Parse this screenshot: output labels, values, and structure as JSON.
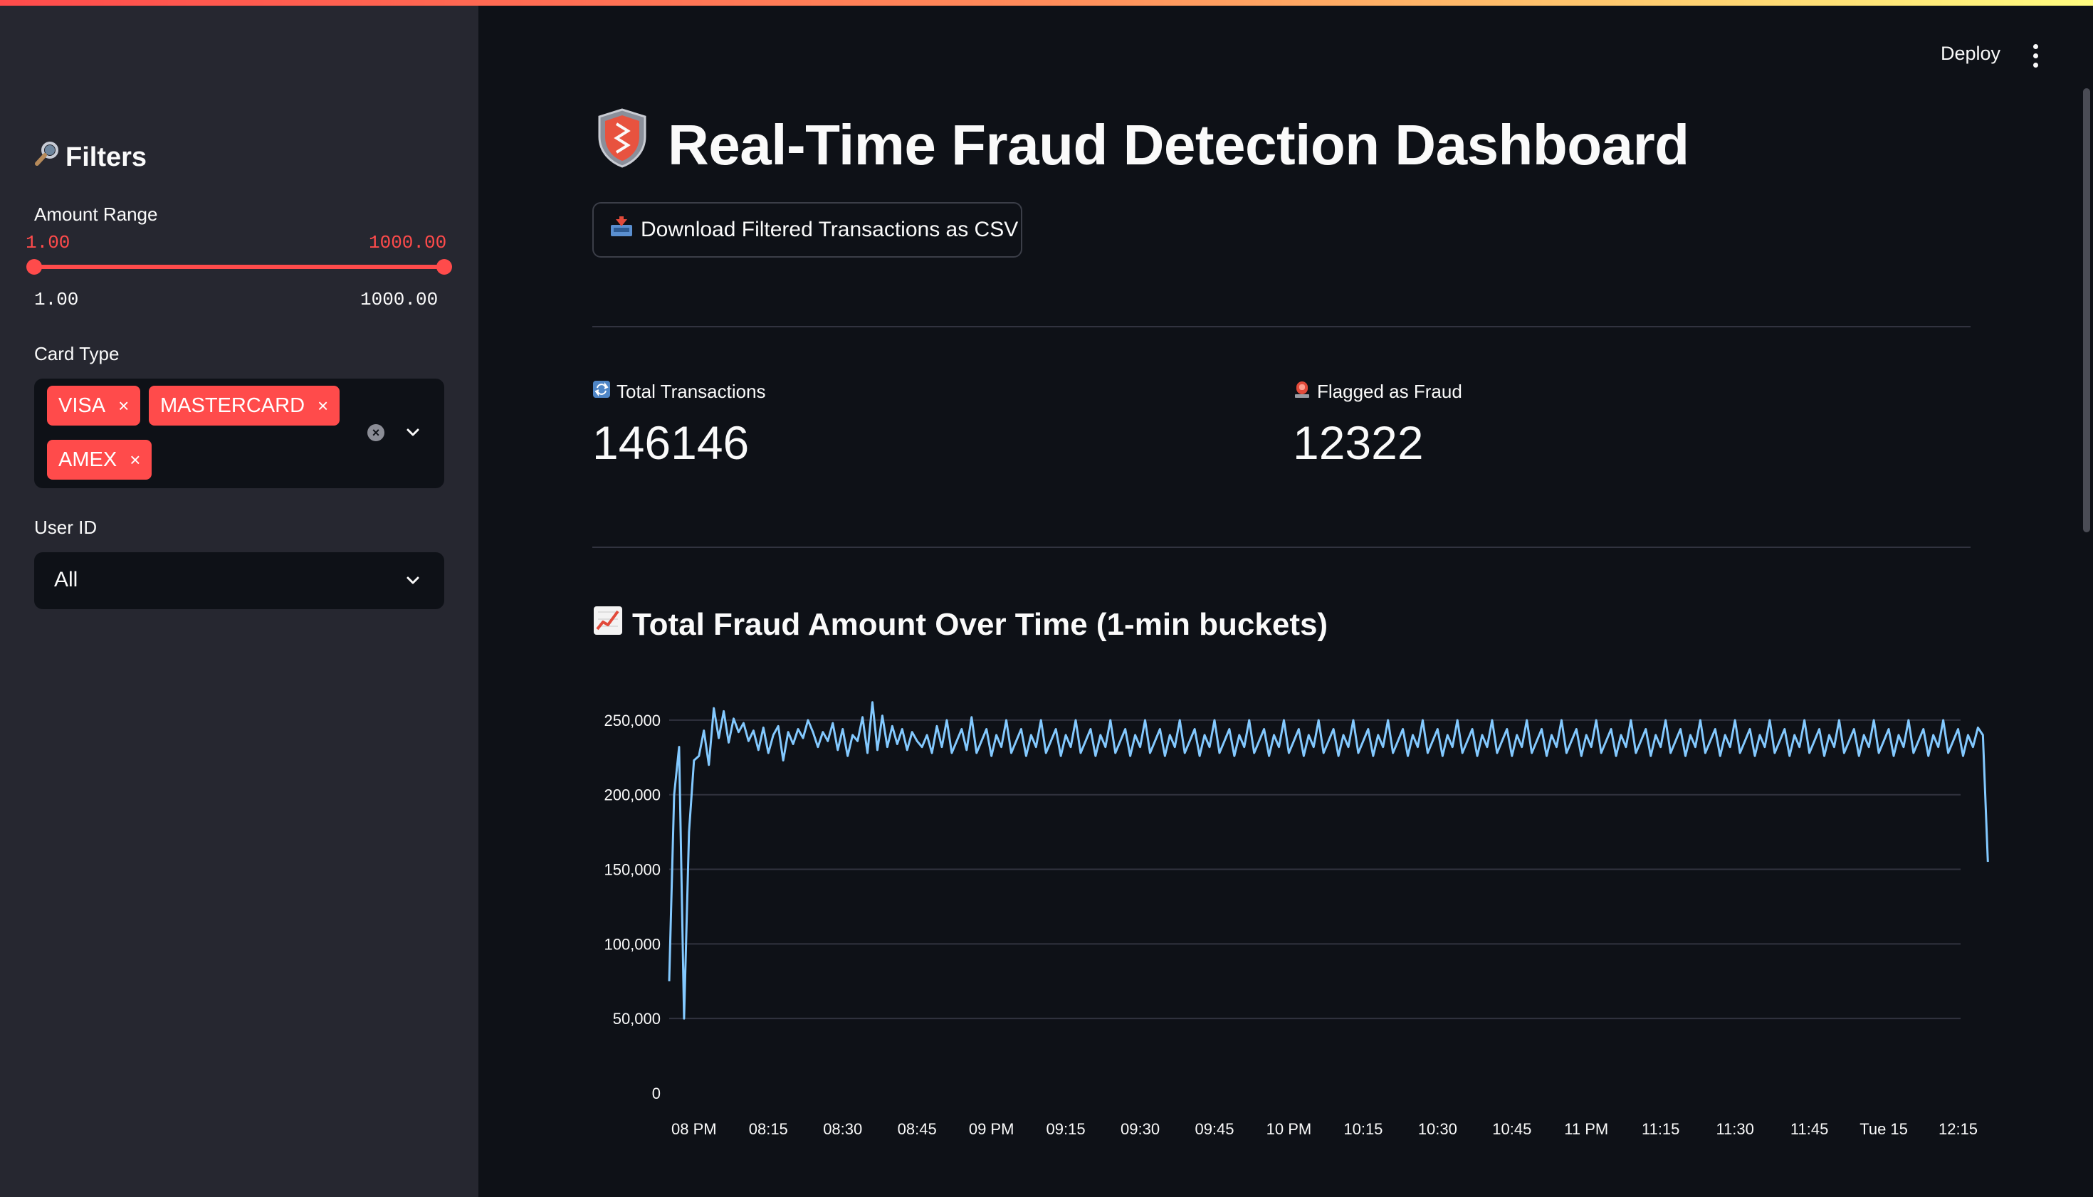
{
  "header": {
    "deploy_label": "Deploy"
  },
  "sidebar": {
    "title": "Filters",
    "title_icon": "magnifier-icon",
    "amount_range": {
      "label": "Amount Range",
      "min_selected": "1.00",
      "max_selected": "1000.00",
      "min_bound": "1.00",
      "max_bound": "1000.00",
      "range_fraction": [
        0,
        1
      ]
    },
    "card_type": {
      "label": "Card Type",
      "chips": [
        "VISA",
        "MASTERCARD",
        "AMEX"
      ],
      "chip_remove_glyph": "×"
    },
    "user_id": {
      "label": "User ID",
      "value": "All"
    }
  },
  "main": {
    "title": "Real-Time Fraud Detection Dashboard",
    "title_icon": "shield-icon",
    "download_label": "Download Filtered Transactions as CSV",
    "download_icon": "inbox-tray-icon",
    "metrics": [
      {
        "label": "Total Transactions",
        "value": "146146",
        "icon": "repeat-icon"
      },
      {
        "label": "Flagged as Fraud",
        "value": "12322",
        "icon": "siren-icon"
      }
    ],
    "chart_title": "Total Fraud Amount Over Time (1-min buckets)",
    "chart_icon": "chart-increasing-icon"
  },
  "colors": {
    "accent": "#ff4b4b",
    "line": "#83c9ff",
    "background": "#0e1117",
    "sidebar": "#262730"
  },
  "chart_data": {
    "type": "line",
    "title": "Total Fraud Amount Over Time (1-min buckets)",
    "xlabel": "",
    "ylabel": "",
    "ylim": [
      0,
      270000
    ],
    "y_ticks": [
      0,
      50000,
      100000,
      150000,
      200000,
      250000
    ],
    "y_tick_labels": [
      "0",
      "50,000",
      "100,000",
      "150,000",
      "200,000",
      "250,000"
    ],
    "x_tick_labels": [
      "08 PM",
      "08:15",
      "08:30",
      "08:45",
      "09 PM",
      "09:15",
      "09:30",
      "09:45",
      "10 PM",
      "10:15",
      "10:30",
      "10:45",
      "11 PM",
      "11:15",
      "11:30",
      "11:45",
      "Tue 15",
      "12:15"
    ],
    "x_tick_minutes": [
      0,
      15,
      30,
      45,
      60,
      75,
      90,
      105,
      120,
      135,
      150,
      165,
      180,
      195,
      210,
      225,
      240,
      255
    ],
    "x_range_minutes": [
      -5,
      255.5
    ],
    "grid": true,
    "series": [
      {
        "x_start_minutes": -5,
        "values": [
          75000,
          200000,
          232000,
          50000,
          175000,
          223000,
          226000,
          243000,
          220000,
          258000,
          238000,
          256000,
          235000,
          251000,
          242000,
          248000,
          236000,
          243000,
          230000,
          245000,
          228000,
          240000,
          246000,
          223000,
          242000,
          234000,
          244000,
          238000,
          250000,
          242000,
          232000,
          242000,
          236000,
          248000,
          230000,
          244000,
          226000,
          240000,
          236000,
          252000,
          228000,
          262000,
          230000,
          253000,
          232000,
          246000,
          234000,
          244000,
          230000,
          242000,
          236000,
          232000,
          240000,
          228000,
          246000,
          232000,
          250000,
          228000,
          236000,
          244000,
          230000,
          252000,
          228000,
          236000,
          244000,
          226000,
          240000,
          232000,
          250000,
          228000,
          236000,
          244000,
          226000,
          240000,
          232000,
          250000,
          228000,
          236000,
          244000,
          226000,
          240000,
          232000,
          250000,
          228000,
          236000,
          244000,
          226000,
          240000,
          232000,
          250000,
          228000,
          236000,
          244000,
          226000,
          240000,
          232000,
          250000,
          228000,
          236000,
          244000,
          226000,
          240000,
          232000,
          250000,
          228000,
          236000,
          244000,
          226000,
          240000,
          232000,
          250000,
          228000,
          236000,
          244000,
          226000,
          240000,
          232000,
          250000,
          228000,
          236000,
          244000,
          226000,
          240000,
          232000,
          250000,
          228000,
          236000,
          244000,
          226000,
          240000,
          232000,
          250000,
          228000,
          236000,
          244000,
          226000,
          240000,
          232000,
          250000,
          228000,
          236000,
          244000,
          226000,
          240000,
          232000,
          250000,
          228000,
          236000,
          244000,
          226000,
          240000,
          232000,
          250000,
          228000,
          236000,
          244000,
          226000,
          240000,
          232000,
          250000,
          228000,
          236000,
          244000,
          226000,
          240000,
          232000,
          250000,
          228000,
          236000,
          244000,
          226000,
          240000,
          232000,
          250000,
          228000,
          236000,
          244000,
          226000,
          240000,
          232000,
          250000,
          228000,
          236000,
          244000,
          226000,
          240000,
          232000,
          250000,
          228000,
          236000,
          244000,
          226000,
          240000,
          232000,
          250000,
          228000,
          236000,
          244000,
          226000,
          240000,
          232000,
          250000,
          228000,
          236000,
          244000,
          226000,
          240000,
          232000,
          250000,
          228000,
          236000,
          244000,
          226000,
          240000,
          232000,
          250000,
          228000,
          236000,
          244000,
          226000,
          240000,
          232000,
          250000,
          228000,
          236000,
          244000,
          226000,
          240000,
          232000,
          250000,
          228000,
          236000,
          244000,
          226000,
          240000,
          232000,
          250000,
          228000,
          236000,
          244000,
          226000,
          240000,
          232000,
          250000,
          228000,
          236000,
          244000,
          226000,
          240000,
          232000,
          250000,
          228000,
          236000,
          244000,
          226000,
          240000,
          232000,
          250000,
          228000,
          236000,
          244000,
          226000,
          240000,
          232000,
          245000,
          240000,
          155000
        ]
      }
    ]
  }
}
